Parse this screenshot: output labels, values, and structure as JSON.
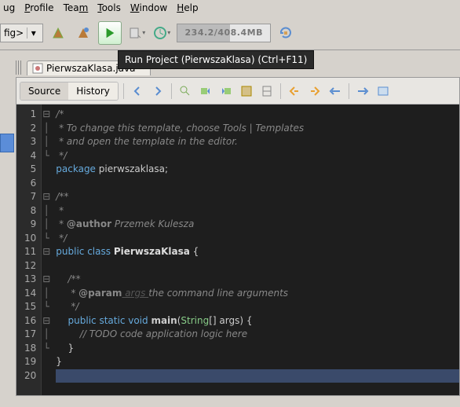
{
  "menu": {
    "ug": "ug",
    "profile": "Profile",
    "team": "Team",
    "tools": "Tools",
    "window": "Window",
    "help": "Help"
  },
  "config_combo": {
    "text": "fig>"
  },
  "tooltip": "Run Project (PierwszaKlasa) (Ctrl+F11)",
  "memory": "234.2/408.4MB",
  "tab": {
    "filename": "PierwszaKlasa.java"
  },
  "editor_tabs": {
    "source": "Source",
    "history": "History"
  },
  "gutter": [
    "1",
    "2",
    "3",
    "4",
    "5",
    "6",
    "7",
    "8",
    "9",
    "10",
    "11",
    "12",
    "13",
    "14",
    "15",
    "16",
    "17",
    "18",
    "19",
    "20"
  ],
  "code": {
    "l1": "/*",
    "l2": " * To change this template, choose Tools | Templates",
    "l3": " * and open the template in the editor.",
    "l4": " */",
    "l5_kw": "package",
    "l5_pkg": " pierwszaklasa",
    "l5_semi": ";",
    "l7": "/**",
    "l8": " *",
    "l9_pre": " * ",
    "l9_tag": "@author",
    "l9_rest": " Przemek Kulesza",
    "l10": " */",
    "l11_pub": "public ",
    "l11_cls": "class ",
    "l11_name": "PierwszaKlasa",
    "l11_brace": " {",
    "l13": "    /**",
    "l14_pre": "     * ",
    "l14_tag": "@param",
    "l14_arg": " args ",
    "l14_rest": "the command line arguments",
    "l15": "     */",
    "l16_ind": "    ",
    "l16_pub": "public ",
    "l16_stat": "static ",
    "l16_void": "void ",
    "l16_main": "main",
    "l16_op": "(",
    "l16_type": "String",
    "l16_arr": "[] ",
    "l16_arg": "args",
    "l16_cp": ") {",
    "l17": "        // TODO code application logic here",
    "l18": "    }",
    "l19": "}"
  }
}
